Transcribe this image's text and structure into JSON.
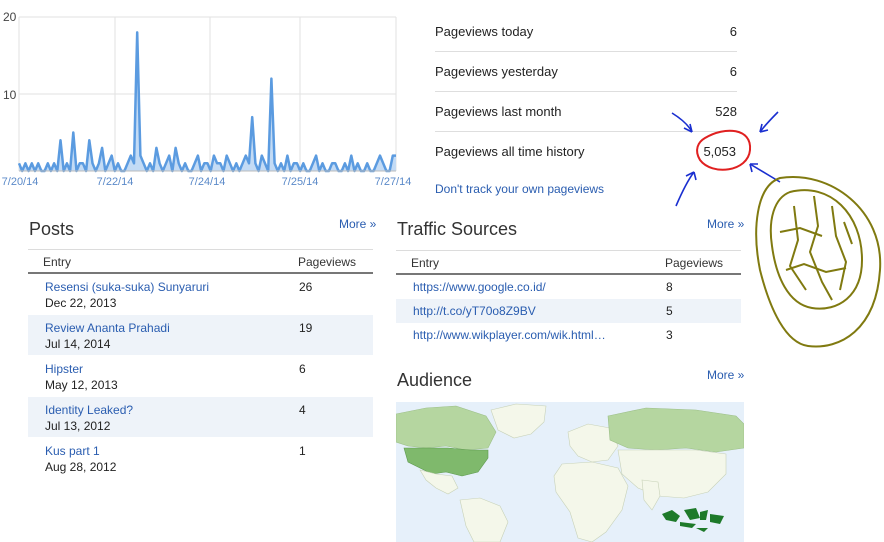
{
  "chart_data": {
    "type": "area",
    "y_ticks": [
      "20",
      "10"
    ],
    "x_labels": [
      "7/20/14",
      "7/22/14",
      "7/24/14",
      "7/25/14",
      "7/27/14"
    ],
    "ylim": [
      0,
      20
    ],
    "grid": true,
    "values": [
      1,
      0,
      1,
      0,
      1,
      0,
      1,
      0,
      0,
      1,
      0,
      1,
      0,
      4,
      0,
      1,
      0,
      5,
      0,
      1,
      1,
      0,
      4,
      1,
      0,
      1,
      3,
      0,
      1,
      2,
      0,
      1,
      0,
      0,
      1,
      2,
      1,
      18,
      2,
      1,
      0,
      1,
      0,
      3,
      1,
      0,
      1,
      2,
      0,
      3,
      1,
      0,
      1,
      0,
      0,
      1,
      2,
      0,
      1,
      1,
      0,
      2,
      1,
      1,
      0,
      2,
      1,
      0,
      1,
      0,
      1,
      2,
      1,
      7,
      1,
      0,
      2,
      1,
      0,
      12,
      1,
      0,
      1,
      0,
      2,
      0,
      1,
      1,
      0,
      1,
      0,
      0,
      1,
      2,
      0,
      1,
      0,
      0,
      1,
      1,
      0,
      0,
      1,
      0,
      2,
      0,
      1,
      0,
      0,
      1,
      0,
      0,
      1,
      2,
      1,
      0,
      0,
      2,
      2
    ]
  },
  "stats": [
    {
      "label": "Pageviews today",
      "value": "6"
    },
    {
      "label": "Pageviews yesterday",
      "value": "6"
    },
    {
      "label": "Pageviews last month",
      "value": "528"
    },
    {
      "label": "Pageviews all time history",
      "value": "5,053"
    }
  ],
  "track_link": "Don't track your own pageviews",
  "posts": {
    "title": "Posts",
    "more": "More »",
    "col_entry": "Entry",
    "col_pageviews": "Pageviews",
    "rows": [
      {
        "title": "Resensi (suka-suka) Sunyaruri",
        "date": "Dec 22, 2013",
        "pageviews": "26"
      },
      {
        "title": "Review Ananta Prahadi",
        "date": "Jul 14, 2014",
        "pageviews": "19"
      },
      {
        "title": "Hipster",
        "date": "May 12, 2013",
        "pageviews": "6"
      },
      {
        "title": "Identity Leaked?",
        "date": "Jul 13, 2012",
        "pageviews": "4"
      },
      {
        "title": "Kus part 1",
        "date": "Aug 28, 2012",
        "pageviews": "1"
      }
    ]
  },
  "traffic": {
    "title": "Traffic Sources",
    "more": "More »",
    "col_entry": "Entry",
    "col_pageviews": "Pageviews",
    "rows": [
      {
        "url": "https://www.google.co.id/",
        "pageviews": "8"
      },
      {
        "url": "http://t.co/yT70o8Z9BV",
        "pageviews": "5"
      },
      {
        "url": "http://www.wikplayer.com/wik.html…",
        "pageviews": "3"
      }
    ]
  },
  "audience": {
    "title": "Audience",
    "more": "More »"
  },
  "colors": {
    "chart_line": "#5b9be0",
    "link": "#2a5db0",
    "row_alt": "#eef3f9",
    "annotation_red": "#e02020",
    "annotation_blue": "#1a2fd0",
    "annotation_olive": "#807a10",
    "map_ocean": "#e6f0fa",
    "map_land": "#f4f7ea",
    "map_light_green": "#b5d6a0",
    "map_dark_green": "#1e7a2a"
  }
}
